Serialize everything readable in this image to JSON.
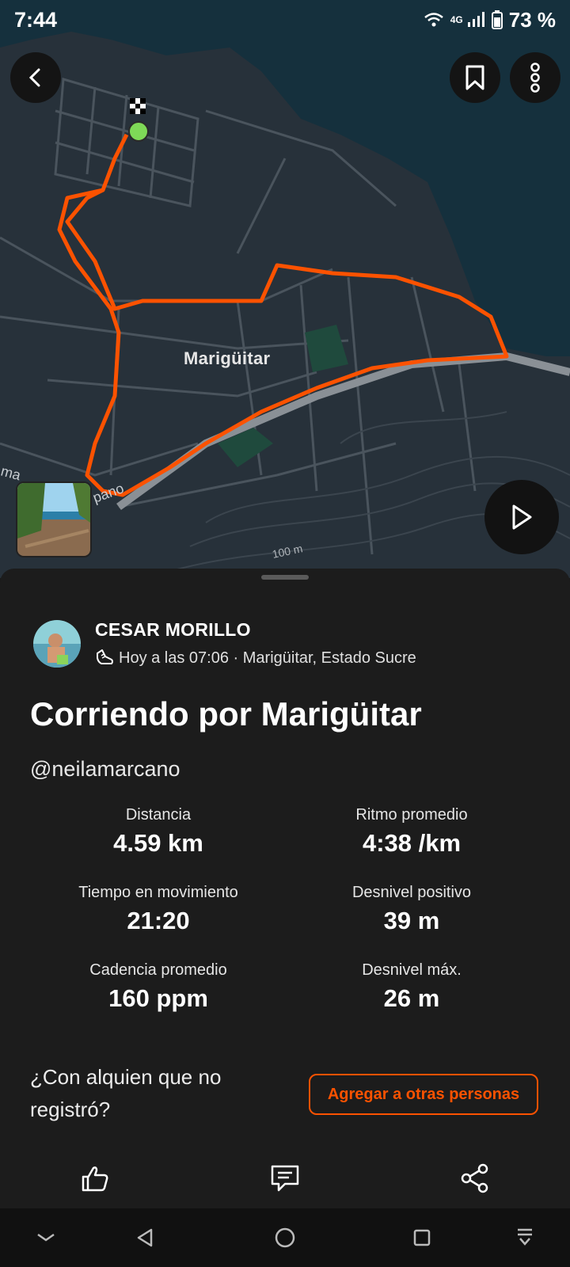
{
  "status_bar": {
    "time": "7:44",
    "network": "4G",
    "battery": "73 %"
  },
  "map": {
    "place_label": "Marigüitar",
    "road_label": "pano",
    "road_label_left": "ma",
    "scale_label": "100 m",
    "route_color": "#fc5200",
    "start_marker_color": "#7ed957",
    "thumbnail_desc": "beach-photo"
  },
  "activity": {
    "user_name": "CESAR MORILLO",
    "meta": "Hoy a las 07:06 · Marigüitar, Estado Sucre",
    "title": "Corriendo por Marigüitar",
    "mention": "@neilamarcano",
    "stats": [
      {
        "label": "Distancia",
        "value": "4.59 km"
      },
      {
        "label": "Ritmo promedio",
        "value": "4:38 /km"
      },
      {
        "label": "Tiempo en movimiento",
        "value": "21:20"
      },
      {
        "label": "Desnivel positivo",
        "value": "39 m"
      },
      {
        "label": "Cadencia promedio",
        "value": "160 ppm"
      },
      {
        "label": "Desnivel máx.",
        "value": "26 m"
      }
    ],
    "question": "¿Con alquien que no registró?",
    "add_button": "Agregar a otras personas"
  },
  "colors": {
    "accent": "#fc5200",
    "sheet_bg": "#1c1c1c",
    "map_land": "#27313a",
    "map_water": "#15303d"
  },
  "icons": [
    "back-arrow-icon",
    "bookmark-icon",
    "more-vertical-icon",
    "play-icon",
    "shoe-icon",
    "like-icon",
    "comment-icon",
    "share-icon"
  ]
}
